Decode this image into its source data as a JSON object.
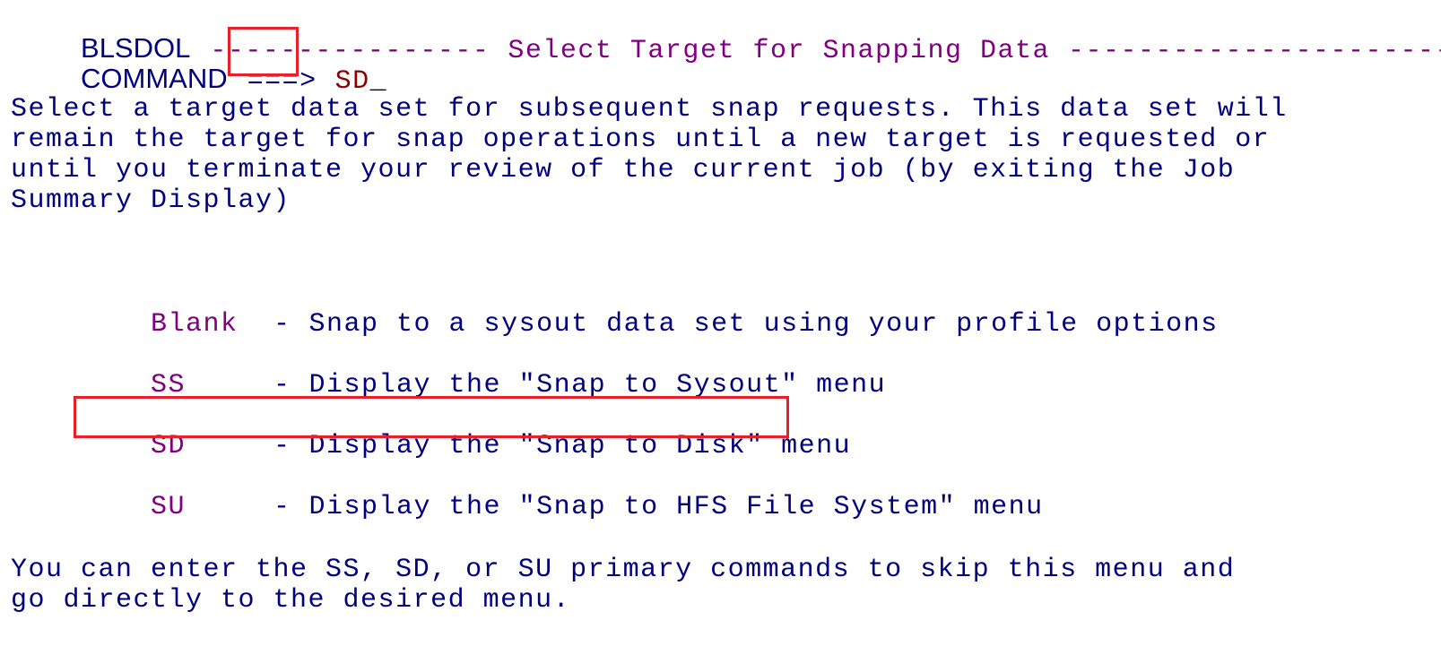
{
  "header": {
    "panel_id": "BLSDOL",
    "dashes_left": "----------------",
    "title": "Select Target for Snapping Data",
    "dashes_right": "----------------------"
  },
  "command": {
    "label": "COMMAND",
    "arrow": "===>",
    "value": "SD",
    "cursor": "_"
  },
  "description": [
    "Select a target data set for subsequent snap requests. This data set will",
    "remain the target for snap operations until a new target is requested or",
    "until you terminate your review of the current job (by exiting the Job",
    "Summary Display)"
  ],
  "options": [
    {
      "code": "Blank",
      "sep": "-",
      "text": "Snap to a sysout data set using your profile options"
    },
    {
      "code": "SS",
      "sep": "-",
      "text": "Display the \"Snap to Sysout\" menu"
    },
    {
      "code": "SD",
      "sep": "-",
      "text": "Display the \"Snap to Disk\" menu",
      "highlighted": true
    },
    {
      "code": "SU",
      "sep": "-",
      "text": "Display the \"Snap to HFS File System\" menu"
    }
  ],
  "footer": [
    "You can enter the SS, SD, or SU primary commands to skip this menu and",
    "go directly to the desired menu."
  ],
  "colors": {
    "text_blue": "#00007f",
    "text_purple": "#800080",
    "input_red": "#8b0000",
    "highlight_box": "#e8202a"
  }
}
